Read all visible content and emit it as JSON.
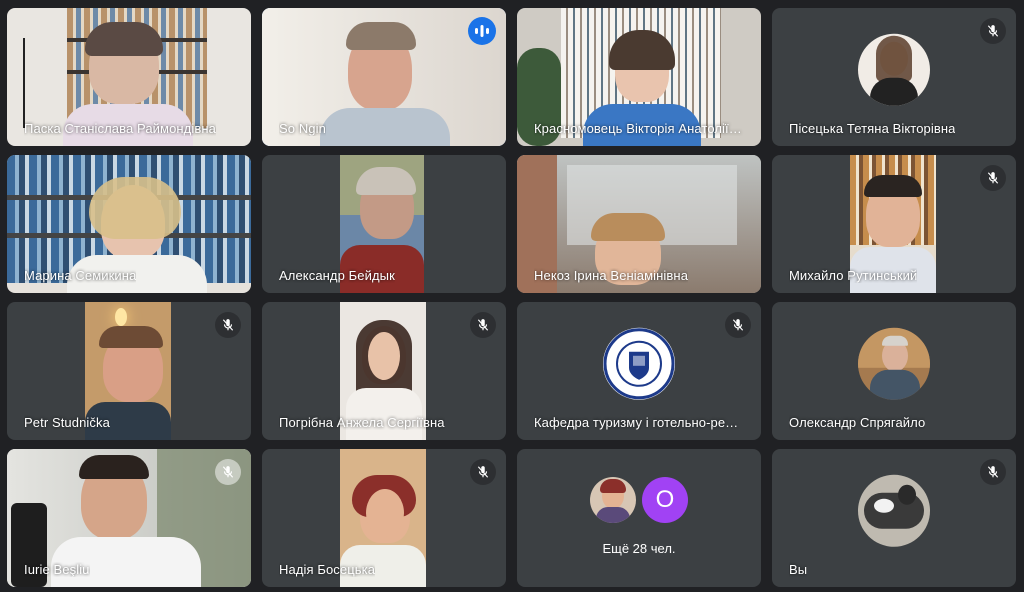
{
  "participants": [
    {
      "name": "Паска Станіслава Раймондівна",
      "muted": false
    },
    {
      "name": "So Ngin",
      "speaking": true
    },
    {
      "name": "Красномовець Вікторія Анатоліївна",
      "muted": false
    },
    {
      "name": "Пісецька Тетяна Вікторівна",
      "muted": true
    },
    {
      "name": "Марина Семикина",
      "muted": false
    },
    {
      "name": "Александр Бейдык",
      "muted": false
    },
    {
      "name": "Некоз Ірина Веніамінівна",
      "muted": false
    },
    {
      "name": "Михайло Рутинський",
      "muted": true
    },
    {
      "name": "Petr Studnička",
      "muted": true
    },
    {
      "name": "Погрібна Анжела Сергіївна",
      "muted": true
    },
    {
      "name": "Кафедра туризму і готельно-ресторанної справи",
      "muted": true
    },
    {
      "name": "Олександр Спрягайло",
      "muted": false
    },
    {
      "name": "Iurie Beşliu",
      "muted": true
    },
    {
      "name": "Надія Босецька",
      "muted": true
    },
    {
      "more_label": "Ещё 28 чел.",
      "letter": "O"
    },
    {
      "name": "Вы",
      "muted": true
    }
  ],
  "logo_text": "КАФЕДРА ТУРИЗМУ І ГОТЕЛЬНО-РЕСТОРАННОЇ СПРАВИ",
  "colors": {
    "background": "#202124",
    "tile": "#3c4043",
    "active_border": "#8ab4f8",
    "speaking_badge": "#1a73e8",
    "letter_avatar": "#a142f4"
  }
}
